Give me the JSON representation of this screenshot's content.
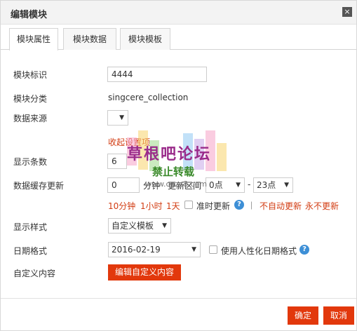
{
  "dialog": {
    "title": "编辑模块",
    "close_icon": "×"
  },
  "tabs": [
    {
      "label": "模块属性",
      "active": true
    },
    {
      "label": "模块数据",
      "active": false
    },
    {
      "label": "模块模板",
      "active": false
    }
  ],
  "form": {
    "module_id": {
      "label": "模块标识",
      "value": "4444"
    },
    "module_category": {
      "label": "模块分类",
      "value": "singcere_collection"
    },
    "data_source": {
      "label": "数据来源",
      "selected": ""
    },
    "collapse_link": "收起设置项",
    "display_count": {
      "label": "显示条数",
      "value": "6"
    },
    "cache_update": {
      "label": "数据缓存更新",
      "value": "0",
      "unit": "分钟",
      "range_label": "更新区间",
      "range_start": "0点",
      "range_dash": "-",
      "range_end": "23点",
      "quick_options": [
        "10分钟",
        "1小时",
        "1天"
      ],
      "on_time_label": "准时更新",
      "no_auto_update": "不自动更新",
      "never_update": "永不更新",
      "separator": "|"
    },
    "display_style": {
      "label": "显示样式",
      "selected": "自定义模板"
    },
    "date_format": {
      "label": "日期格式",
      "selected": "2016-02-19",
      "humanize_label": "使用人性化日期格式"
    },
    "custom_content": {
      "label": "自定义内容",
      "button": "编辑自定义内容"
    }
  },
  "footer": {
    "confirm": "确定",
    "cancel": "取消"
  },
  "watermark": {
    "main": "草根吧论坛",
    "sub": "禁止转载",
    "url": "www.cgzz8.com"
  },
  "colors": {
    "accent_red": "#e2380c",
    "link_red": "#d23c12",
    "help_blue": "#3d8fd6"
  }
}
